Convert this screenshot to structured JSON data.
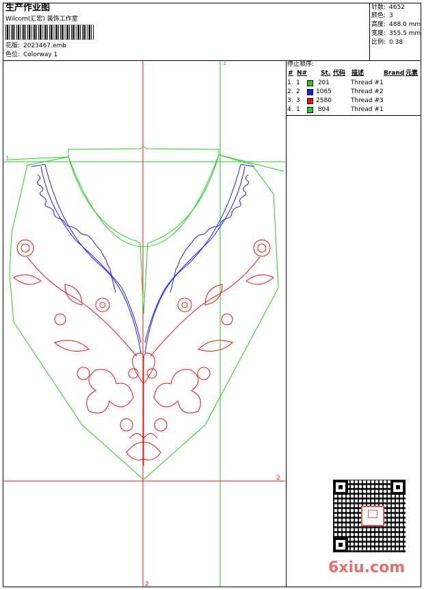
{
  "header": {
    "title": "生产作业图",
    "company": "Wilcom(汇宏) 装饰工作室",
    "design_label": "花版:",
    "design_value": "2023467.emb",
    "color_label": "色位:",
    "color_value": "Colorway 1"
  },
  "stats": [
    {
      "label": "针数:",
      "value": "4652"
    },
    {
      "label": "颜色:",
      "value": "3"
    },
    {
      "label": "高度:",
      "value": "488.0 mm"
    },
    {
      "label": "宽度:",
      "value": "355.5 mm"
    },
    {
      "label": "比例:",
      "value": "0.38"
    }
  ],
  "stop_sequence": {
    "title": "停止顺序:",
    "headers": {
      "num": "#",
      "n": "N#",
      "st": "St.",
      "code": "代码",
      "desc": "描述",
      "brand": "Brand",
      "element": "元素"
    },
    "rows": [
      {
        "num": "1.",
        "n": "1",
        "color": "#22cc22",
        "st": "201",
        "desc": "Thread #1"
      },
      {
        "num": "2.",
        "n": "2",
        "color": "#1a1aff",
        "st": "1065",
        "desc": "Thread #2"
      },
      {
        "num": "3.",
        "n": "3",
        "color": "#ee1111",
        "st": "2580",
        "desc": "Thread #3"
      },
      {
        "num": "4.",
        "n": "1",
        "color": "#22cc22",
        "st": "804",
        "desc": "Thread #1"
      }
    ]
  },
  "guides": {
    "green_top_label": "1",
    "green_left_label": "1",
    "red_right_label": "2",
    "red_bottom_label": "2"
  },
  "colors": {
    "outline": "#22cc22",
    "blue": "#1a1aff",
    "red": "#ee1111",
    "border": "#000000"
  },
  "watermark": "6xiu.com",
  "qr_seal_text": "汉服图"
}
